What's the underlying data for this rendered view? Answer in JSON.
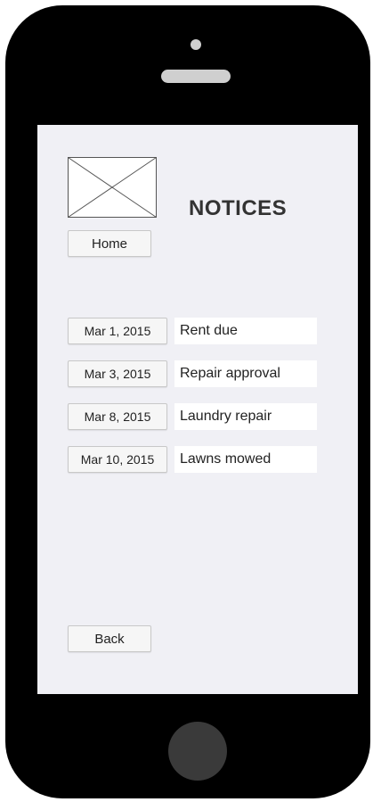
{
  "header": {
    "title": "NOTICES",
    "logo_icon": "image-placeholder-icon"
  },
  "nav": {
    "home_label": "Home",
    "back_label": "Back"
  },
  "notices": [
    {
      "date": "Mar 1, 2015",
      "text": "Rent due"
    },
    {
      "date": "Mar 3, 2015",
      "text": "Repair approval"
    },
    {
      "date": "Mar 8, 2015",
      "text": "Laundry repair"
    },
    {
      "date": "Mar 10, 2015",
      "text": "Lawns mowed"
    }
  ],
  "colors": {
    "phone_body": "#000000",
    "screen_background": "#f0f0f5",
    "button_background": "#f6f6f6",
    "title_text": "#333333"
  }
}
